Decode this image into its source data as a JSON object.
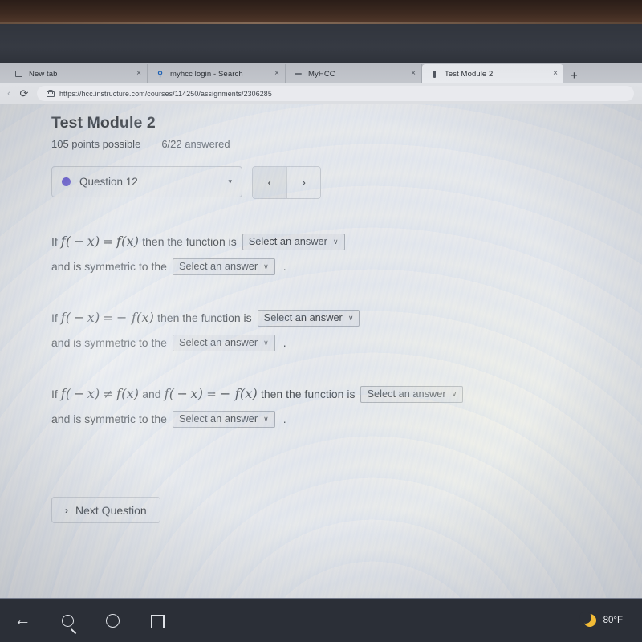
{
  "browser": {
    "tabs": [
      {
        "title": "New tab",
        "icon": "new-tab-icon",
        "close": "×",
        "active": false
      },
      {
        "title": "myhcc login - Search",
        "icon": "search-icon",
        "close": "×",
        "active": false
      },
      {
        "title": "MyHCC",
        "icon": "dash-icon",
        "close": "×",
        "active": false
      },
      {
        "title": "Test Module 2",
        "icon": "bar-icon",
        "close": "×",
        "active": true
      }
    ],
    "new_tab_button": "+",
    "back_chevron": "‹",
    "reload_icon": "⟳",
    "url": "https://hcc.instructure.com/courses/114250/assignments/2306285"
  },
  "quiz": {
    "title": "Test Module 2",
    "points_possible": "105 points possible",
    "answered": "6/22 answered",
    "question_selector": {
      "label": "Question 12",
      "caret": "▾",
      "status_color": "#5b4bcc"
    },
    "prev_button": "‹",
    "next_button": "›",
    "select_placeholder": "Select an answer",
    "select_caret": "∨",
    "questions": [
      {
        "id": "q-even",
        "line1": {
          "prefix": "If",
          "expr_left": "f( − x)",
          "operator": "=",
          "expr_right": "f(x)",
          "text": "then the function is",
          "select": "Select an answer"
        },
        "line2": {
          "text": "and is symmetric to the",
          "select": "Select an answer",
          "period": "."
        }
      },
      {
        "id": "q-odd",
        "line1": {
          "prefix": "If",
          "expr_left": "f( − x)",
          "operator": "=",
          "expr_right": "− f(x)",
          "text": "then the function is",
          "select": "Select an answer"
        },
        "line2": {
          "text": "and is symmetric to the",
          "select": "Select an answer",
          "period": "."
        }
      },
      {
        "id": "q-neither",
        "line1": {
          "prefix": "If",
          "expr_left": "f( − x)",
          "operator": "≠",
          "expr_right": "f(x)",
          "conjunction": "and",
          "expr_left2": "f( − x)",
          "operator2": "=",
          "expr_right2": "− f(x)",
          "text": "then the function is",
          "select": "Select an answer"
        },
        "line2": {
          "text": "and is symmetric to the",
          "select": "Select an answer",
          "period": "."
        }
      }
    ],
    "next_question_button": {
      "chevron": "›",
      "label": "Next Question"
    }
  },
  "taskbar": {
    "back_arrow": "←",
    "items": [
      "back-arrow-icon",
      "search-icon",
      "cortana-icon",
      "task-view-icon"
    ],
    "weather": {
      "icon": "moon-icon",
      "temperature": "80°F",
      "icon_color": "#f2bb36"
    }
  }
}
